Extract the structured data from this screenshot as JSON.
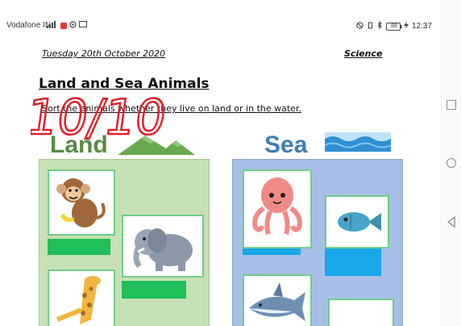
{
  "status_bar": {
    "carrier": "Vodafone IN",
    "time": "12:37",
    "battery": "88"
  },
  "document": {
    "date": "Tuesday 20th October 2020",
    "subject": "Science",
    "title": "Land and Sea Animals",
    "instruction": "Sort the animals whether they live on land or in the water.",
    "grade": "10/10"
  },
  "land": {
    "label": "Land",
    "animals": [
      "monkey",
      "elephant",
      "giraffe"
    ]
  },
  "sea": {
    "label": "Sea",
    "animals": [
      "octopus",
      "fish",
      "shark"
    ]
  },
  "colors": {
    "land_label": "#5a8a46",
    "sea_label": "#3f7cb6",
    "land_bg": "#c8e0b5",
    "sea_bg": "#a7bfe6",
    "green_bar": "#1fc05a",
    "blue_bar": "#18a7e8",
    "grade_ink": "#e0202a"
  }
}
